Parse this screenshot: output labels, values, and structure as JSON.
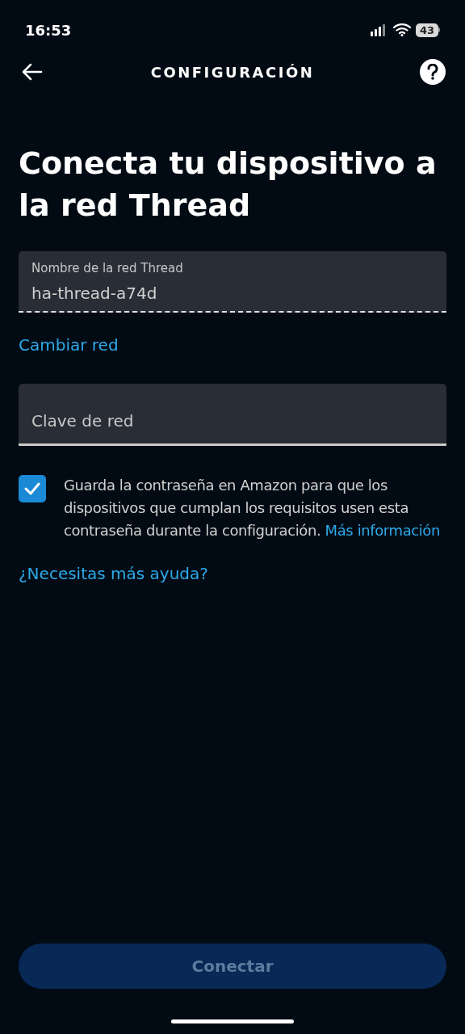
{
  "status_bar": {
    "time": "16:53",
    "battery": "43"
  },
  "header": {
    "title": "CONFIGURACIÓN"
  },
  "heading": "Conecta tu dispositivo a la red Thread",
  "network_name_field": {
    "label": "Nombre de la red Thread",
    "value": "ha-thread-a74d"
  },
  "change_network_link": "Cambiar red",
  "network_key_field": {
    "placeholder": "Clave de red"
  },
  "save_password": {
    "checked": true,
    "text": "Guarda la contraseña en Amazon para que los dispositivos que cumplan los requisitos usen esta contraseña durante la configuración.",
    "link": "Más información"
  },
  "help_link": "¿Necesitas más ayuda?",
  "connect_button": {
    "label": "Conectar",
    "disabled": true
  }
}
